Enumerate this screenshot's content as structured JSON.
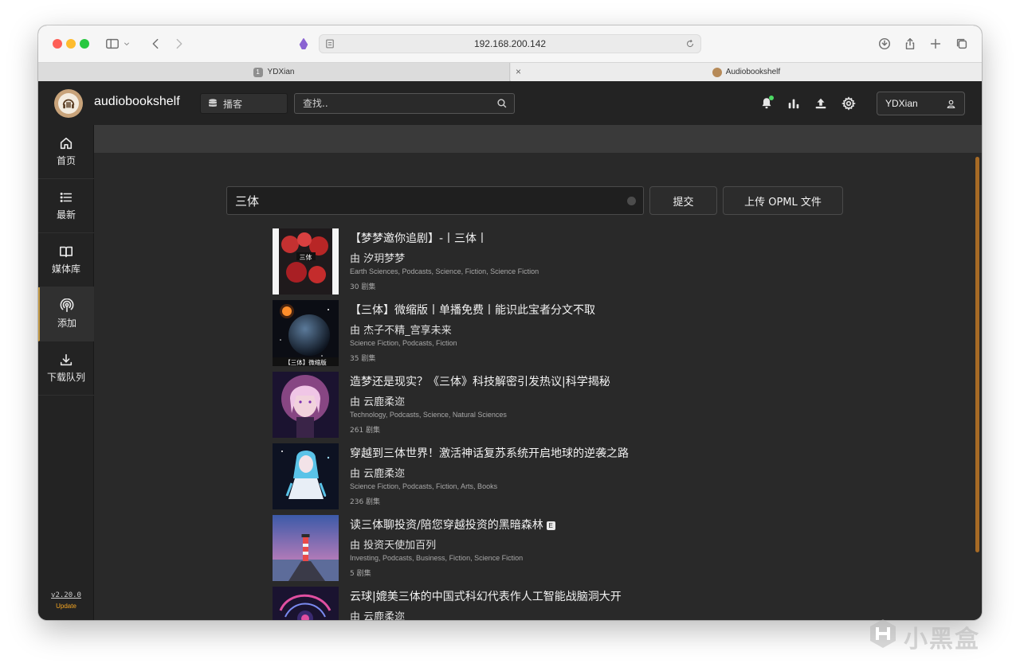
{
  "browser": {
    "url": "192.168.200.142",
    "tabs": [
      {
        "badge": "1",
        "label": "YDXian"
      },
      {
        "label": "Audiobookshelf"
      }
    ]
  },
  "header": {
    "brand": "audiobookshelf",
    "library": "播客",
    "search_placeholder": "查找..",
    "user": "YDXian"
  },
  "sidebar": {
    "items": [
      {
        "label": "首页",
        "icon": "home-icon"
      },
      {
        "label": "最新",
        "icon": "list-icon"
      },
      {
        "label": "媒体库",
        "icon": "book-icon"
      },
      {
        "label": "添加",
        "icon": "podcast-icon",
        "active": true
      },
      {
        "label": "下载队列",
        "icon": "download-icon"
      }
    ],
    "version": "v2.20.0",
    "update": "Update"
  },
  "search": {
    "value": "三体",
    "submit": "提交",
    "upload_opml": "上传 OPML 文件"
  },
  "results": [
    {
      "title": "【梦梦邀你追剧】-丨三体丨",
      "author": "由 汐玥梦梦",
      "genres": "Earth Sciences, Podcasts, Science, Fiction, Science Fiction",
      "episodes": "30 剧集",
      "cover_text": "三体"
    },
    {
      "title": "【三体】微缩版丨单播免费丨能识此宝者分文不取",
      "author": "由 杰子不精_宫享未来",
      "genres": "Science Fiction, Podcasts, Fiction",
      "episodes": "35 剧集",
      "cover_text": "【三体】微缩版"
    },
    {
      "title": "造梦还是现实？《三体》科技解密引发热议|科学揭秘",
      "author": "由 云鹿柔迩",
      "genres": "Technology, Podcasts, Science, Natural Sciences",
      "episodes": "261 剧集"
    },
    {
      "title": "穿越到三体世界！激活神话复苏系统开启地球的逆袭之路",
      "author": "由 云鹿柔迩",
      "genres": "Science Fiction, Podcasts, Fiction, Arts, Books",
      "episodes": "236 剧集"
    },
    {
      "title": "读三体聊投资/陪您穿越投资的黑暗森林",
      "explicit": "E",
      "author": "由 投资天使加百列",
      "genres": "Investing, Podcasts, Business, Fiction, Science Fiction",
      "episodes": "5 剧集"
    },
    {
      "title": "云球|媲美三体的中国式科幻代表作人工智能战脑洞大开",
      "author": "由 云鹿柔迩",
      "genres": "",
      "episodes": ""
    }
  ],
  "watermark": "小黑盒",
  "colors": {
    "accent": "#c49a45",
    "scroll": "#a66a25",
    "update": "#f5a623"
  }
}
